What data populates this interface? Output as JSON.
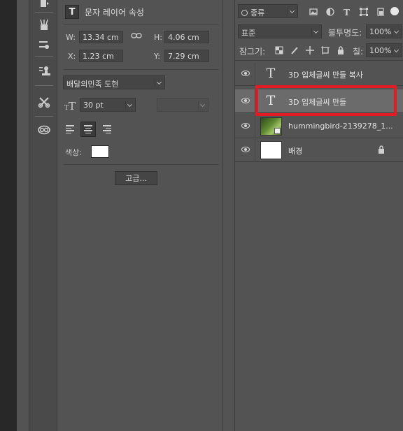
{
  "properties": {
    "title": "문자 레이어 속성",
    "t_icon": "T",
    "w_label": "W:",
    "w_value": "13.34 cm",
    "h_label": "H:",
    "h_value": "4.06 cm",
    "x_label": "X:",
    "x_value": "1.23 cm",
    "y_label": "Y:",
    "y_value": "7.29 cm",
    "font_family": "배달의민족 도현",
    "font_size": "30 pt",
    "color_label": "색상:",
    "advanced_button": "고급...",
    "text_color": "#ffffff"
  },
  "layers": {
    "filter_kind": "종류",
    "blend_mode": "표준",
    "opacity_label": "불투명도:",
    "opacity_value": "100%",
    "lock_label": "잠그기:",
    "fill_label": "칠:",
    "fill_value": "100%",
    "items": [
      {
        "name": "3D 입체글씨 만들 복사",
        "type": "text",
        "icon": "T"
      },
      {
        "name": "3D 입체글씨 만들",
        "type": "text",
        "icon": "T",
        "selected": true
      },
      {
        "name": "hummingbird-2139278_1...",
        "type": "smart-object"
      },
      {
        "name": "배경",
        "type": "background",
        "locked": true
      }
    ]
  },
  "colors": {
    "panel": "#535353",
    "highlight": "#e31b23",
    "selected_row": "#6b6b6b"
  }
}
